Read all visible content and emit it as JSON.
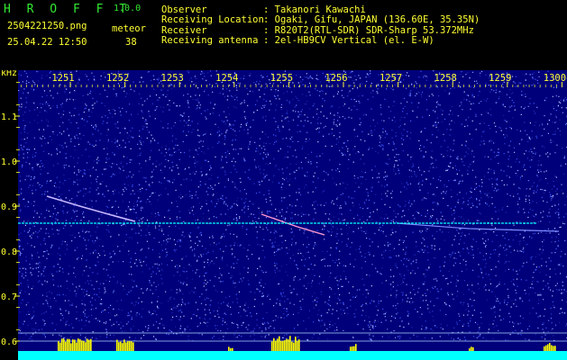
{
  "app": {
    "name": "H R O F F T",
    "version": "1.0.0"
  },
  "file": {
    "name": "2504221250.png",
    "datetime": "25.04.22 12:50"
  },
  "meteor": {
    "label": "meteor",
    "count": "38"
  },
  "station": [
    {
      "key": "Observer",
      "value": ": Takanori Kawachi"
    },
    {
      "key": "Receiving Location",
      "value": ": Ogaki, Gifu, JAPAN (136.60E, 35.35N)"
    },
    {
      "key": "Receiver",
      "value": ": R820T2(RTL-SDR) SDR-Sharp 53.372MHz"
    },
    {
      "key": "Receiving antenna",
      "value": ": 2el-HB9CV Vertical (el. E-W)"
    }
  ],
  "axis": {
    "y_unit": "kHz",
    "y_ticks": [
      "1.1",
      "1.0",
      "0.9",
      "0.8",
      "0.7",
      "0.6"
    ],
    "x_ticks": [
      "1251",
      "1252",
      "1253",
      "1254",
      "1255",
      "1256",
      "1257",
      "1258",
      "1259",
      "1300"
    ]
  },
  "colors": {
    "background": "#000000",
    "spectrum": "#00007a",
    "title_green": "#33e833",
    "label_yellow": "#ffff33",
    "carrier_cyan": "#00ffff",
    "level_yellow": "#ffff00"
  }
}
